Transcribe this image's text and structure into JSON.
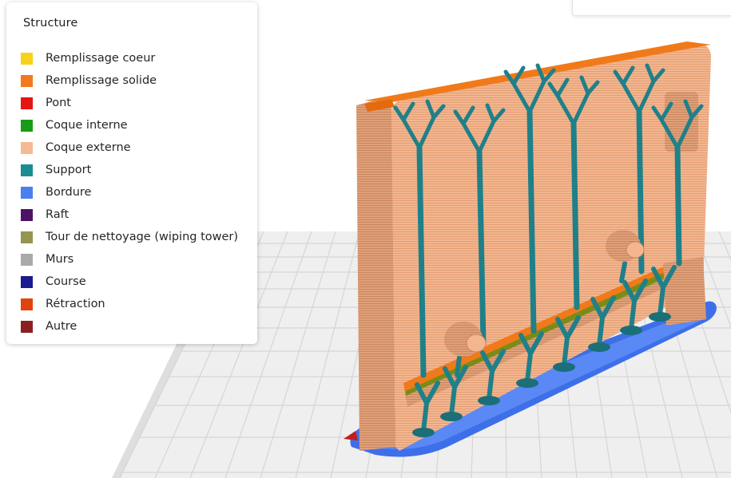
{
  "legend": {
    "title": "Structure",
    "items": [
      {
        "label": "Remplissage coeur",
        "color": "#f8d21a"
      },
      {
        "label": "Remplissage solide",
        "color": "#f4781d"
      },
      {
        "label": "Pont",
        "color": "#e41512"
      },
      {
        "label": "Coque interne",
        "color": "#1a9a16"
      },
      {
        "label": "Coque externe",
        "color": "#f6b993"
      },
      {
        "label": "Support",
        "color": "#1a8d91"
      },
      {
        "label": "Bordure",
        "color": "#4a7ff2"
      },
      {
        "label": "Raft",
        "color": "#4e1368"
      },
      {
        "label": "Tour de nettoyage (wiping tower)",
        "color": "#959550"
      },
      {
        "label": "Murs",
        "color": "#aaaaaa"
      },
      {
        "label": "Course",
        "color": "#1b1a8e"
      },
      {
        "label": "Rétraction",
        "color": "#e2430e"
      },
      {
        "label": "Autre",
        "color": "#8a2020"
      }
    ]
  },
  "viewport": {
    "model": "3d-print-part-preview",
    "colors": {
      "shell": "#f3b68f",
      "support": "#1f8089",
      "brim": "#3f73ef",
      "solid_infill": "#f07a1a",
      "bed_grid_line": "#d8d8d8",
      "bed": "#f0f0f0"
    }
  }
}
